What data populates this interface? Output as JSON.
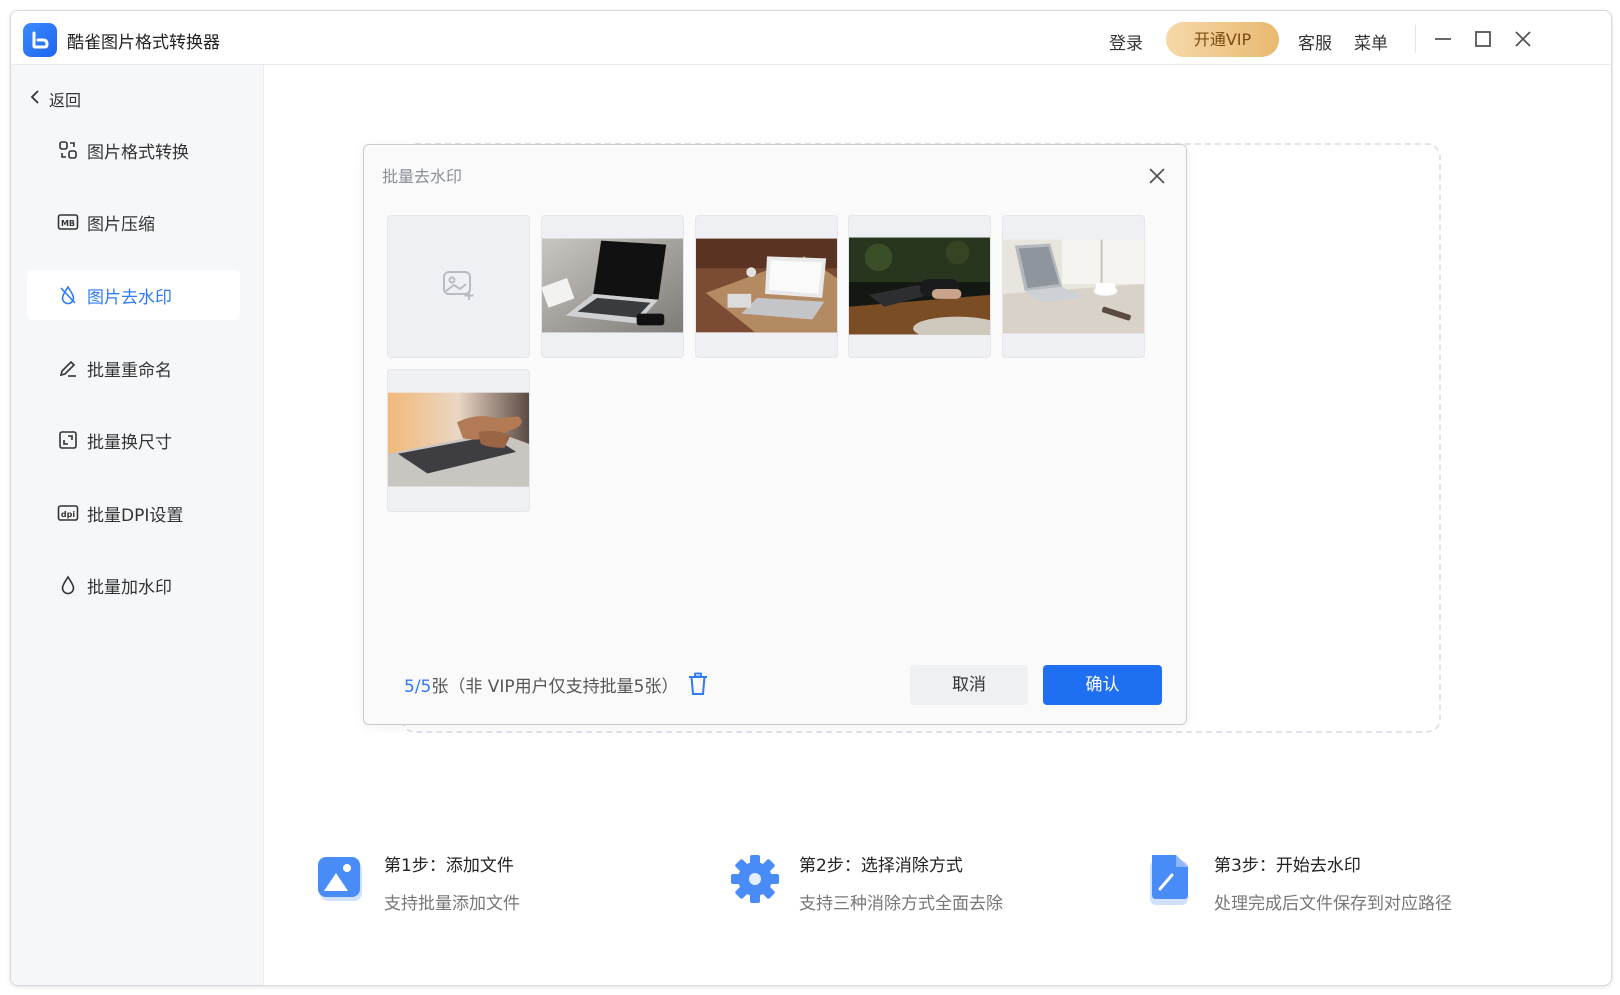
{
  "app": {
    "title": "酷雀图片格式转换器"
  },
  "header": {
    "login": "登录",
    "vip": "开通VIP",
    "service": "客服",
    "menu": "菜单"
  },
  "sidebar": {
    "back_label": "返回",
    "items": [
      {
        "label": "图片格式转换",
        "icon": "format-convert-icon"
      },
      {
        "label": "图片压缩",
        "icon": "mb-compress-icon"
      },
      {
        "label": "图片去水印",
        "icon": "no-watermark-icon",
        "active": true
      },
      {
        "label": "批量重命名",
        "icon": "pen-icon"
      },
      {
        "label": "批量换尺寸",
        "icon": "resize-icon"
      },
      {
        "label": "批量DPI设置",
        "icon": "dpi-icon"
      },
      {
        "label": "批量加水印",
        "icon": "drop-icon"
      }
    ]
  },
  "modal": {
    "title": "批量去水印",
    "count_current": "5/5",
    "count_suffix": "张（非 VIP用户仅支持批量5张）",
    "cancel": "取消",
    "confirm": "确认",
    "images": [
      {
        "name": "laptop-black-desk"
      },
      {
        "name": "laptop-wood-table"
      },
      {
        "name": "laptop-dark-typing"
      },
      {
        "name": "laptop-window-coffee"
      },
      {
        "name": "hands-keyboard"
      }
    ]
  },
  "steps": [
    {
      "title": "第1步：添加文件",
      "desc": "支持批量添加文件",
      "icon": "image-add-icon"
    },
    {
      "title": "第2步：选择消除方式",
      "desc": "支持三种消除方式全面去除",
      "icon": "gear-icon"
    },
    {
      "title": "第3步：开始去水印",
      "desc": "处理完成后文件保存到对应路径",
      "icon": "document-edit-icon"
    }
  ],
  "colors": {
    "accent": "#2f7bf5",
    "primary_button": "#1e6ff2",
    "vip_gold": "#e9b970"
  }
}
